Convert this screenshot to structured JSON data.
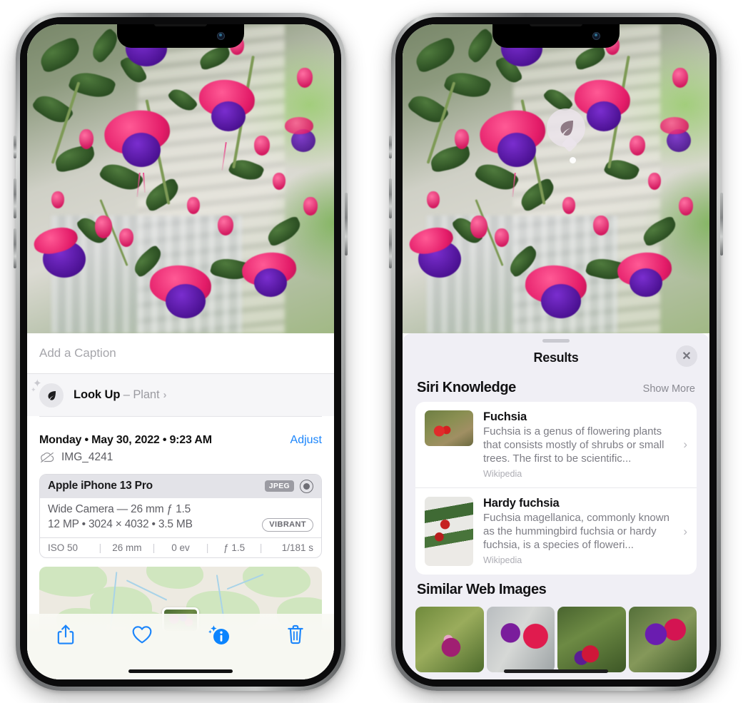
{
  "left_phone": {
    "photo": {
      "alt_name": "fuchsia-flowers-photo"
    },
    "caption": {
      "placeholder": "Add a Caption",
      "value": ""
    },
    "look_up": {
      "icon": "leaf-icon",
      "label": "Look Up",
      "dash": " – ",
      "subject": "Plant",
      "chevron": "›"
    },
    "date_row": {
      "date": "Monday • May 30, 2022 • 9:23 AM",
      "adjust_label": "Adjust"
    },
    "file_row": {
      "icon": "icloud-slash-icon",
      "filename": "IMG_4241"
    },
    "exif": {
      "device": "Apple iPhone 13 Pro",
      "format_badge": "JPEG",
      "raw_icon": "aperture-icon",
      "lens_line": "Wide Camera — 26 mm ƒ 1.5",
      "spec_line": "12 MP • 3024 × 4032 • 3.5 MB",
      "style_badge": "VIBRANT",
      "settings": [
        {
          "label": "ISO 50"
        },
        {
          "label": "26 mm"
        },
        {
          "label": "0 ev"
        },
        {
          "label": "ƒ 1.5"
        },
        {
          "label": "1/181 s"
        }
      ],
      "separator": "|"
    },
    "map": {
      "name": "location-map-preview"
    },
    "toolbar": [
      {
        "icon": "share-icon",
        "name": "share-button"
      },
      {
        "icon": "heart-icon",
        "name": "favorite-button"
      },
      {
        "icon": "info-sparkle-icon",
        "name": "info-button",
        "active": true
      },
      {
        "icon": "trash-icon",
        "name": "delete-button"
      }
    ],
    "accent_color": "#1b85fb"
  },
  "right_phone": {
    "visual_lookup_badge": {
      "icon": "leaf-icon",
      "name": "visual-look-up-badge"
    },
    "results": {
      "title": "Results",
      "close_label": "✕",
      "sections": [
        {
          "title": "Siri Knowledge",
          "action_label": "Show More",
          "items": [
            {
              "title": "Fuchsia",
              "description": "Fuchsia is a genus of flowering plants that consists mostly of shrubs or small trees. The first to be scientific...",
              "source": "Wikipedia",
              "chevron": "›",
              "thumb": "fuchsia-thumbnail"
            },
            {
              "title": "Hardy fuchsia",
              "description": "Fuchsia magellanica, commonly known as the hummingbird fuchsia or hardy fuchsia, is a species of floweri...",
              "source": "Wikipedia",
              "chevron": "›",
              "thumb": "hardy-fuchsia-thumbnail"
            }
          ]
        },
        {
          "title": "Similar Web Images",
          "images": [
            {
              "name": "web-image-1"
            },
            {
              "name": "web-image-2"
            },
            {
              "name": "web-image-3"
            },
            {
              "name": "web-image-4"
            }
          ]
        }
      ]
    }
  },
  "colors": {
    "accent_blue": "#1b85fb",
    "sheet_bg": "#f0eff5",
    "card_bg": "#ffffff",
    "secondary_text": "#7d7d85",
    "badge_gray": "#9b9ba2"
  }
}
